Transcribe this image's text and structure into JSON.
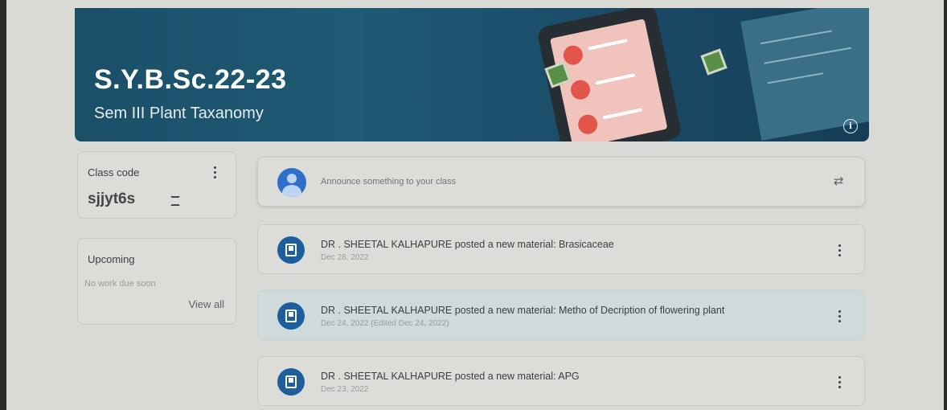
{
  "banner": {
    "title": "S.Y.B.Sc.22-23",
    "subtitle": "Sem III Plant Taxanomy",
    "info_icon": "info-icon"
  },
  "class_code": {
    "label": "Class code",
    "value": "sjjyt6s",
    "menu_icon": "more-vert-icon",
    "expand_icon": "fullscreen-icon"
  },
  "upcoming": {
    "title": "Upcoming",
    "empty_text": "No work due soon",
    "view_all_label": "View all"
  },
  "announce": {
    "placeholder": "Announce something to your class",
    "repost_icon": "repost-icon"
  },
  "posts": [
    {
      "title": "DR . SHEETAL KALHAPURE posted a new material: Brasicaceae",
      "date": "Dec 28, 2022"
    },
    {
      "title": "DR . SHEETAL KALHAPURE posted a new material: Metho of Decription of flowering plant",
      "date": "Dec 24, 2022 (Edited Dec 24, 2022)"
    },
    {
      "title": "DR . SHEETAL KALHAPURE posted a new material: APG",
      "date": "Dec 23, 2022"
    }
  ],
  "colors": {
    "banner": "#1e5a73",
    "post_icon": "#1d5f9c",
    "avatar": "#2f6ec9",
    "hovered_row": "#cfdadb"
  }
}
